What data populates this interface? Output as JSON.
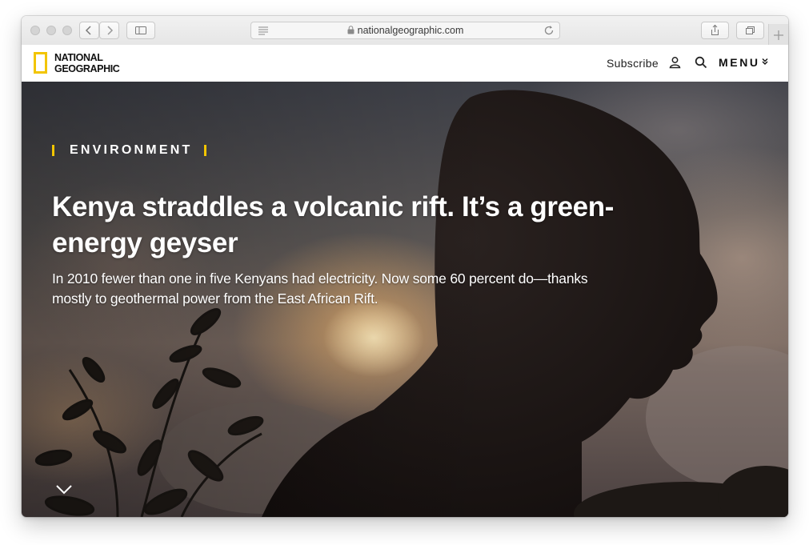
{
  "browser": {
    "address": "nationalgeographic.com",
    "icons": [
      "back-arrow-icon",
      "forward-arrow-icon",
      "sidebar-icon",
      "reader-icon",
      "lock-icon",
      "reload-icon",
      "share-icon",
      "tabs-icon",
      "plus-icon"
    ]
  },
  "site": {
    "logo_line1": "NATIONAL",
    "logo_line2": "GEOGRAPHIC",
    "nav": {
      "subscribe": "Subscribe",
      "menu": "MENU"
    },
    "icons": [
      "user-icon",
      "search-icon",
      "menu-chevron-icon"
    ]
  },
  "hero": {
    "kicker": "ENVIRONMENT",
    "headline": "Kenya straddles a volcanic rift. It’s a green-energy geyser",
    "dek": "In 2010 fewer than one in five Kenyans had electricity. Now some 60 percent do—thanks mostly to geothermal power from the East African Rift.",
    "scroll_icon": "chevron-down-icon"
  },
  "colors": {
    "brand_yellow": "#f2c500",
    "text_dark": "#111111"
  }
}
